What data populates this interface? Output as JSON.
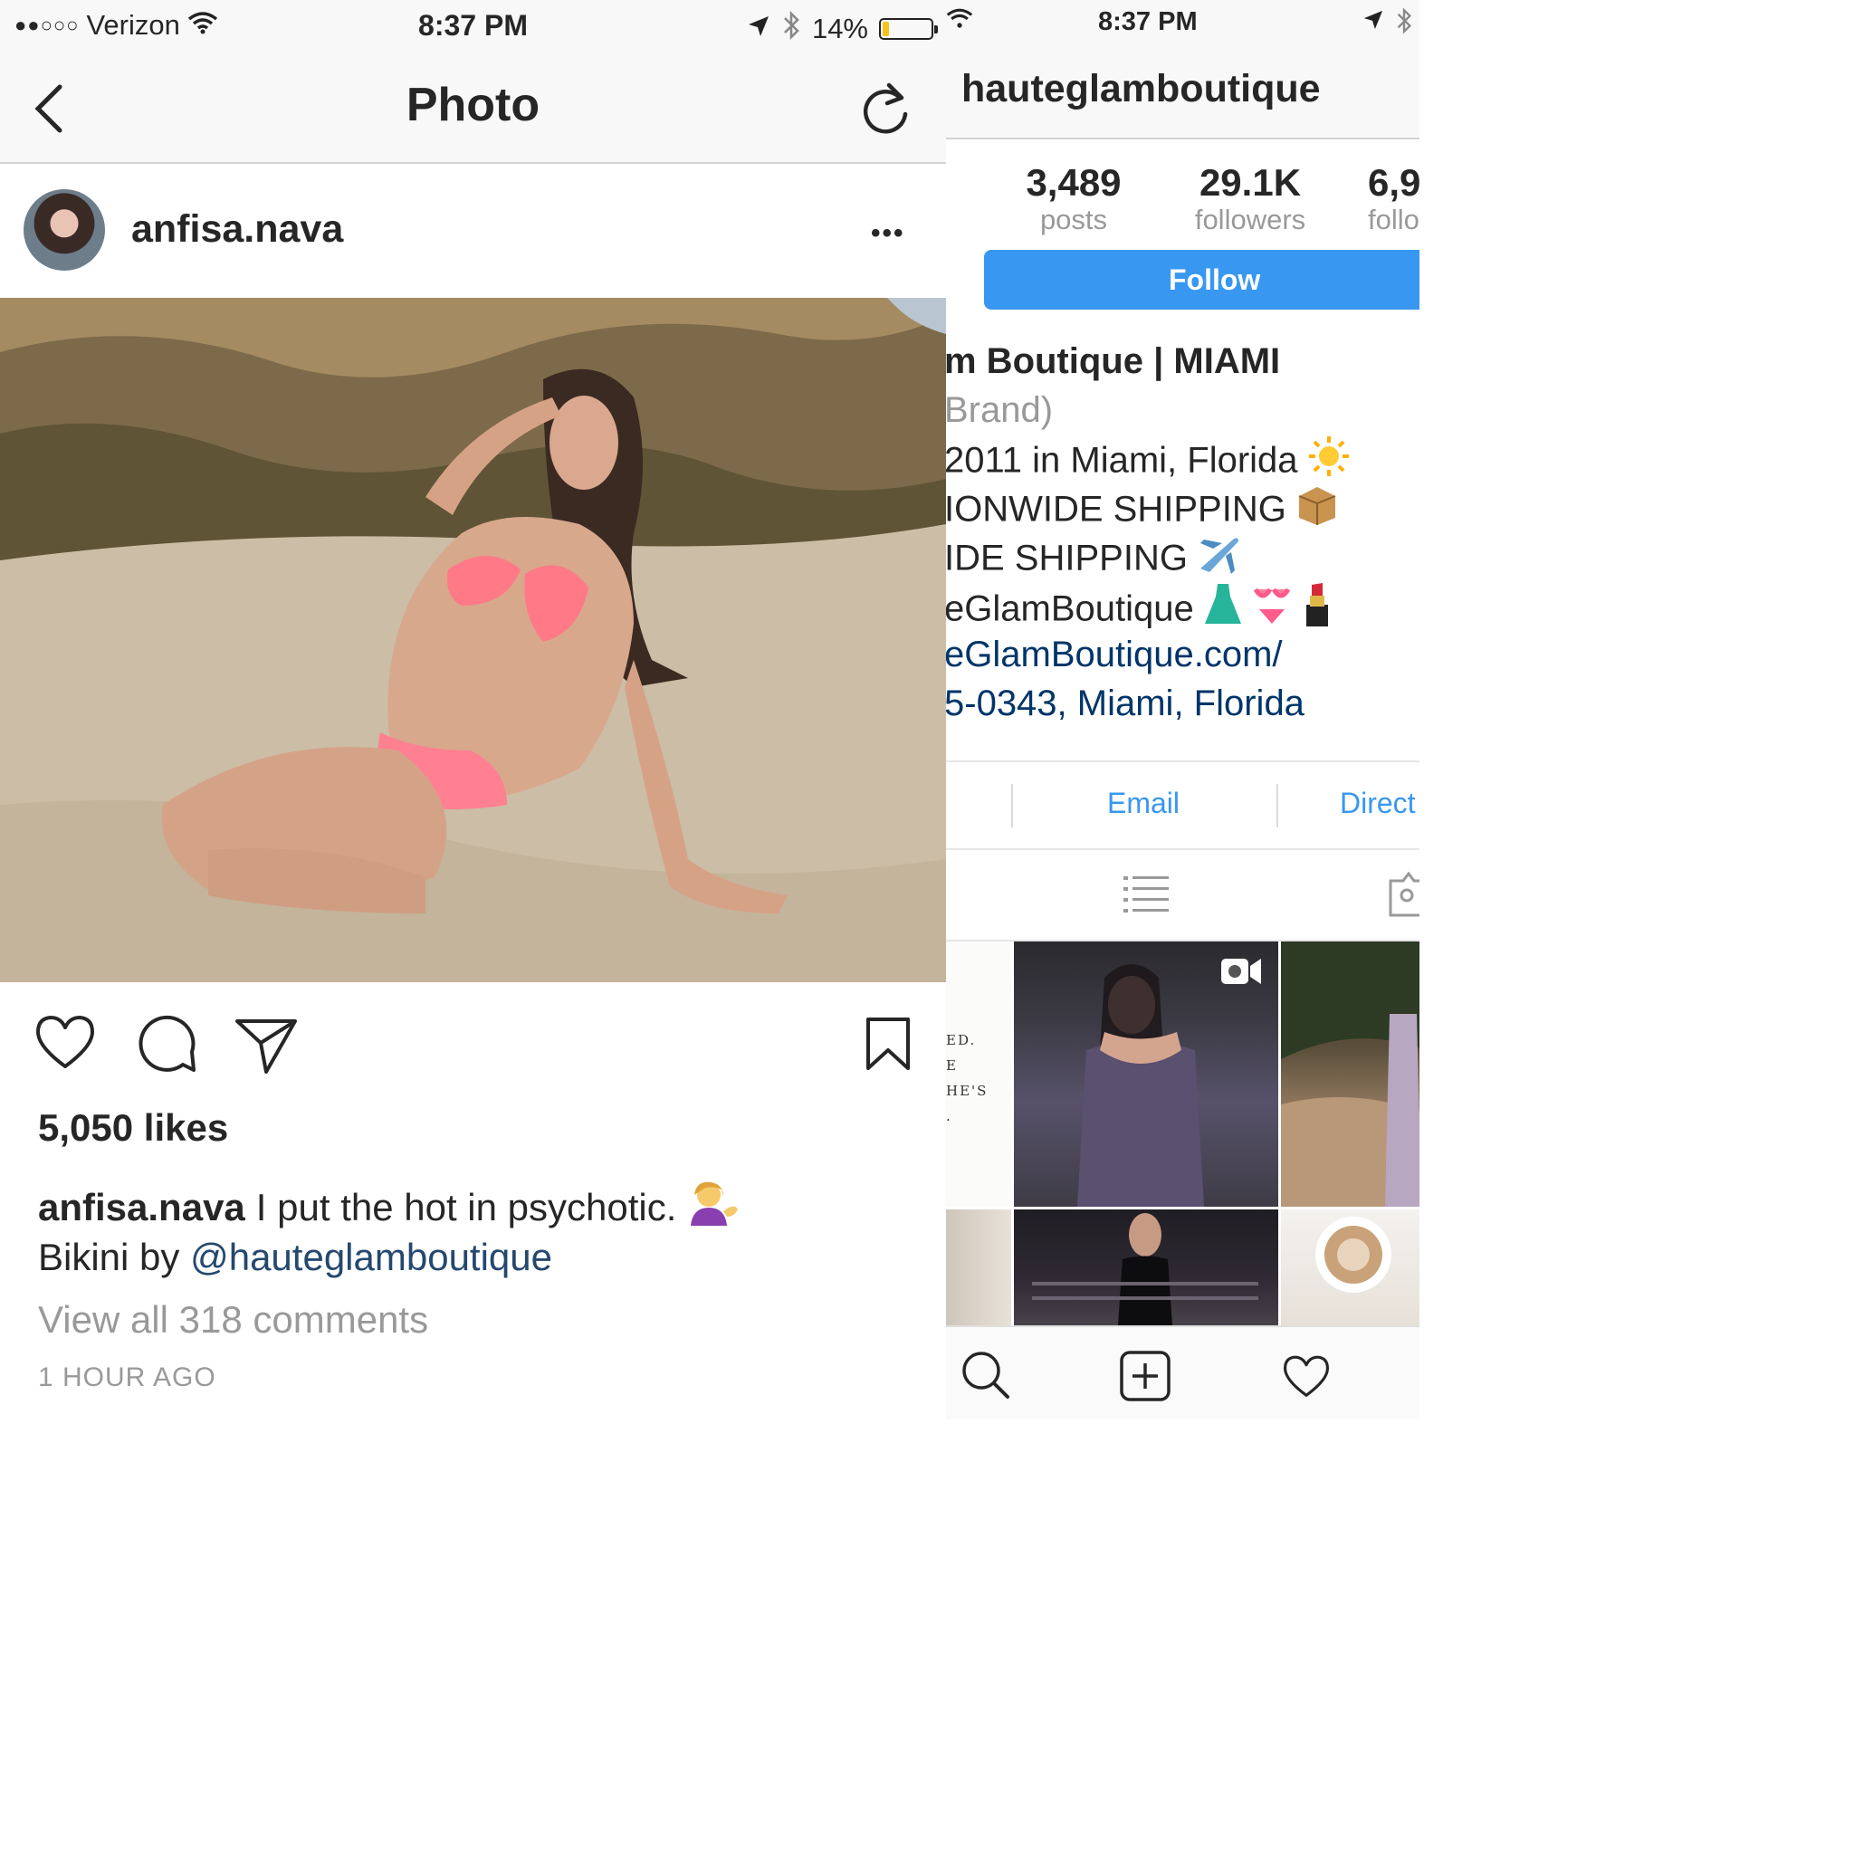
{
  "left": {
    "status_bar": {
      "signal_dots": "●●○○○",
      "carrier": "Verizon",
      "time": "8:37 PM",
      "battery_text": "14%",
      "battery_level": 0.14
    },
    "nav": {
      "title": "Photo",
      "back_icon": "chevron-left-icon",
      "refresh_icon": "refresh-icon"
    },
    "post": {
      "username": "anfisa.nava",
      "more_label": "•••",
      "likes": "5,050 likes",
      "caption_user": "anfisa.nava",
      "caption_text": "I put the hot in psychotic.",
      "caption_line2_prefix": "Bikini by",
      "caption_mention": "@hauteglamboutique",
      "view_comments": "View all 318 comments",
      "timestamp": "1 HOUR AGO"
    }
  },
  "right": {
    "status_bar": {
      "time": "8:37 PM"
    },
    "username": "hauteglamboutique",
    "stats": [
      {
        "value": "3,489",
        "label": "posts"
      },
      {
        "value": "29.1K",
        "label": "followers"
      },
      {
        "value": "6,9",
        "label": "follo"
      }
    ],
    "follow_label": "Follow",
    "bio": {
      "name_line": "m Boutique | MIAMI",
      "category_line": "Brand)",
      "lines": [
        "2011 in Miami, Florida",
        "IONWIDE SHIPPING",
        "IDE SHIPPING",
        "eGlamBoutique"
      ],
      "website": "eGlamBoutique.com/",
      "address": "5-0343, Miami, Florida"
    },
    "contact": {
      "email_label": "Email",
      "direct_label": "Direct"
    },
    "grid_text": "ED.\nE\nHE'S\n."
  },
  "colors": {
    "accent_blue": "#3897f0",
    "link_dark": "#003569",
    "mention": "#24486e",
    "muted": "#999999",
    "battery": "#f5c31a"
  }
}
